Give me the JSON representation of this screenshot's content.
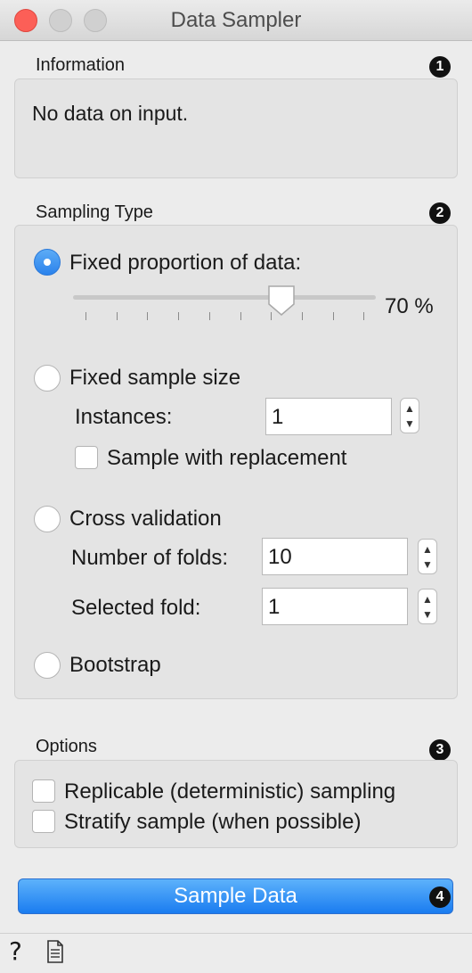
{
  "window": {
    "title": "Data Sampler"
  },
  "information": {
    "heading": "Information",
    "badge": "1",
    "message": "No data on input."
  },
  "sampling_type": {
    "heading": "Sampling Type",
    "badge": "2",
    "fixed_proportion": {
      "label": "Fixed proportion of data:",
      "checked": true,
      "slider_value": 70,
      "value_text": "70 %"
    },
    "fixed_size": {
      "label": "Fixed sample size",
      "instances_label": "Instances:",
      "instances_value": "1",
      "replacement_label": "Sample with replacement"
    },
    "cross_validation": {
      "label": "Cross validation",
      "folds_label": "Number of folds:",
      "folds_value": "10",
      "selected_fold_label": "Selected fold:",
      "selected_fold_value": "1"
    },
    "bootstrap": {
      "label": "Bootstrap"
    }
  },
  "options": {
    "heading": "Options",
    "badge": "3",
    "replicable_label": "Replicable (deterministic) sampling",
    "stratify_label": "Stratify sample (when possible)"
  },
  "action": {
    "sample_button": "Sample Data",
    "badge": "4"
  },
  "footer": {
    "help_icon": "question-icon",
    "report_icon": "report-icon"
  }
}
